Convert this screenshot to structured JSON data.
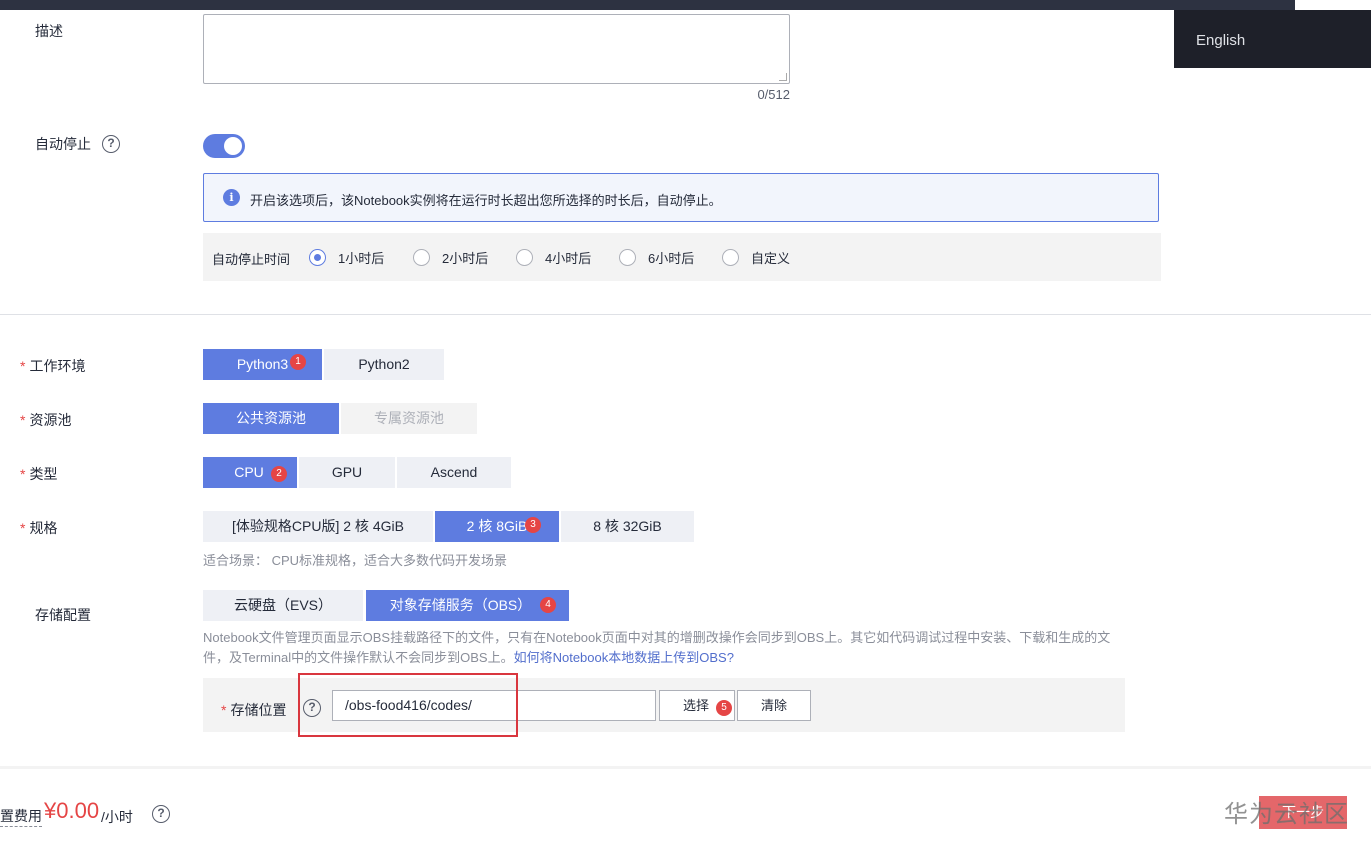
{
  "top": {
    "language": "English"
  },
  "description": {
    "label": "描述",
    "value": "",
    "counter": "0/512"
  },
  "auto_stop": {
    "label": "自动停止",
    "help_glyph": "?",
    "enabled": true,
    "info_glyph": "i",
    "info_text": "开启该选项后，该Notebook实例将在运行时长超出您所选择的时长后，自动停止。",
    "time_label": "自动停止时间",
    "options": [
      "1小时后",
      "2小时后",
      "4小时后",
      "6小时后",
      "自定义"
    ],
    "selected": "1小时后"
  },
  "work_env": {
    "required": "*",
    "label": "工作环境",
    "options": [
      "Python3",
      "Python2"
    ],
    "selected": "Python3",
    "badge": "1"
  },
  "resource_pool": {
    "required": "*",
    "label": "资源池",
    "options": [
      "公共资源池",
      "专属资源池"
    ],
    "selected": "公共资源池"
  },
  "type": {
    "required": "*",
    "label": "类型",
    "options": [
      "CPU",
      "GPU",
      "Ascend"
    ],
    "selected": "CPU",
    "badge": "2"
  },
  "spec": {
    "required": "*",
    "label": "规格",
    "options": [
      "[体验规格CPU版] 2 核 4GiB",
      "2 核 8GiB",
      "8 核 32GiB"
    ],
    "selected": "2 核 8GiB",
    "badge": "3",
    "hint": "适合场景： CPU标准规格，适合大多数代码开发场景"
  },
  "storage": {
    "label": "存储配置",
    "options": [
      "云硬盘（EVS）",
      "对象存储服务（OBS）"
    ],
    "selected": "对象存储服务（OBS）",
    "badge": "4",
    "note": "Notebook文件管理页面显示OBS挂载路径下的文件，只有在Notebook页面中对其的增删改操作会同步到OBS上。其它如代码调试过程中安装、下载和生成的文件，及Terminal中的文件操作默认不会同步到OBS上。",
    "note_link": "如何将Notebook本地数据上传到OBS?",
    "location_required": "*",
    "location_label": "存储位置",
    "location_help": "?",
    "location_value": "/obs-food416/codes/",
    "select_button": "选择",
    "select_badge": "5",
    "clear_button": "清除"
  },
  "footer": {
    "fee_label": "置费用",
    "price": "¥0.00",
    "unit": "/小时",
    "help_glyph": "?",
    "next_button": "下一步",
    "watermark": "华为云社区"
  },
  "colors": {
    "primary": "#5e7ce0",
    "danger": "#e54545",
    "highlight_box": "#d9363e"
  }
}
